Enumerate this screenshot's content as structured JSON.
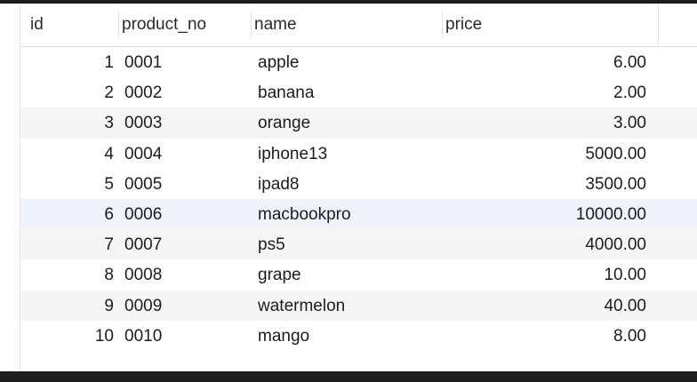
{
  "table": {
    "columns": [
      "id",
      "product_no",
      "name",
      "price"
    ],
    "rows": [
      {
        "id": "1",
        "product_no": "0001",
        "name": "apple",
        "price": "6.00"
      },
      {
        "id": "2",
        "product_no": "0002",
        "name": "banana",
        "price": "2.00"
      },
      {
        "id": "3",
        "product_no": "0003",
        "name": "orange",
        "price": "3.00"
      },
      {
        "id": "4",
        "product_no": "0004",
        "name": "iphone13",
        "price": "5000.00"
      },
      {
        "id": "5",
        "product_no": "0005",
        "name": "ipad8",
        "price": "3500.00"
      },
      {
        "id": "6",
        "product_no": "0006",
        "name": "macbookpro",
        "price": "10000.00"
      },
      {
        "id": "7",
        "product_no": "0007",
        "name": "ps5",
        "price": "4000.00"
      },
      {
        "id": "8",
        "product_no": "0008",
        "name": "grape",
        "price": "10.00"
      },
      {
        "id": "9",
        "product_no": "0009",
        "name": "watermelon",
        "price": "40.00"
      },
      {
        "id": "10",
        "product_no": "0010",
        "name": "mango",
        "price": "8.00"
      }
    ]
  },
  "colors": {
    "row_alt": "#f5f5f5",
    "row_highlight": "#eef3fa",
    "frame": "#1e1e1e"
  }
}
